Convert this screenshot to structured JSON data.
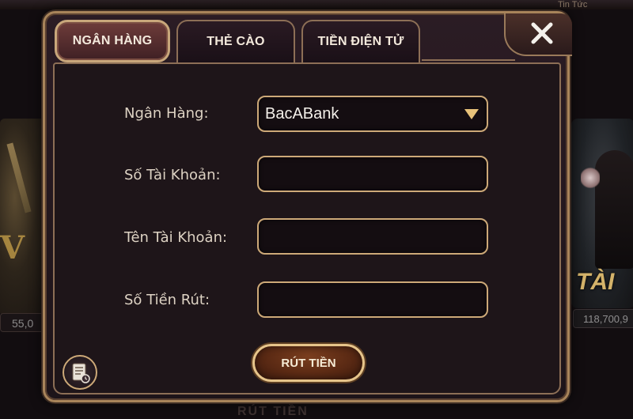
{
  "background": {
    "topright_label": "Tin Tức",
    "left_amount": "55,0",
    "right_amount": "118,700,9",
    "right_card_title": "TÀI",
    "left_card_glyph": "V",
    "bottom_label": "RÚT TIỀN"
  },
  "tabs": [
    {
      "label": "NGÂN HÀNG",
      "active": true
    },
    {
      "label": "THẺ CÀO",
      "active": false
    },
    {
      "label": "TIỀN ĐIỆN TỬ",
      "active": false
    }
  ],
  "form": {
    "bank_label": "Ngân Hàng:",
    "bank_value": "BacABank",
    "account_number_label": "Số Tài Khoản:",
    "account_number_value": "",
    "account_name_label": "Tên Tài Khoản:",
    "account_name_value": "",
    "amount_label": "Số Tiền Rút:",
    "amount_value": ""
  },
  "withdraw_button_label": "RÚT TIỀN",
  "icons": {
    "close": "close-icon",
    "dropdown": "triangle-down-icon",
    "history": "document-history-icon"
  },
  "colors": {
    "gold_border": "#cda978",
    "panel_bg": "#1e1519",
    "button_fill": "#5b2a14"
  }
}
